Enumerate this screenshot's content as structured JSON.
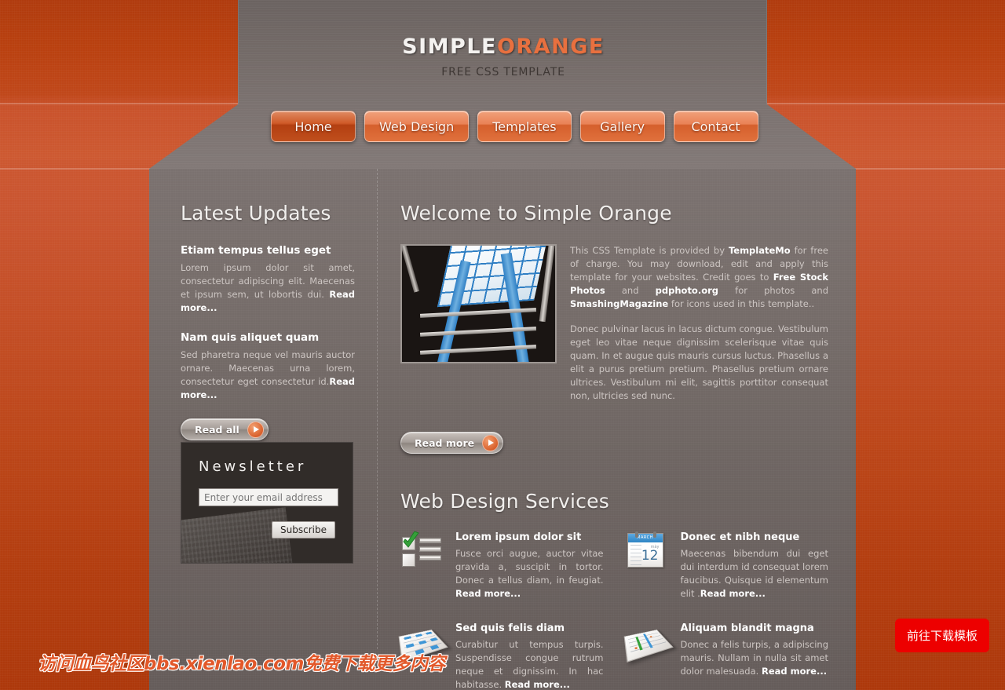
{
  "header": {
    "brand_primary": "SIMPLE",
    "brand_accent": "ORANGE",
    "tagline": "FREE CSS TEMPLATE",
    "accent_color": "#e8703f"
  },
  "nav": {
    "items": [
      {
        "label": "Home",
        "active": true
      },
      {
        "label": "Web Design",
        "active": false
      },
      {
        "label": "Templates",
        "active": false
      },
      {
        "label": "Gallery",
        "active": false
      },
      {
        "label": "Contact",
        "active": false
      }
    ]
  },
  "sidebar": {
    "title": "Latest Updates",
    "updates": [
      {
        "title": "Etiam tempus tellus eget",
        "text": "Lorem ipsum dolor sit amet, consectetur adipiscing elit. Maecenas et ipsum sem, ut lobortis dui. ",
        "read_more": "Read more..."
      },
      {
        "title": "Nam quis aliquet quam",
        "text": "Sed pharetra neque vel mauris auctor ornare. Maecenas urna lorem, consectetur eget consectetur id.",
        "read_more": "Read more..."
      }
    ],
    "read_all_label": "Read all"
  },
  "newsletter": {
    "title": "Newsletter",
    "input_placeholder": "Enter your email address",
    "input_value": "",
    "subscribe_label": "Subscribe"
  },
  "welcome": {
    "title": "Welcome to Simple Orange",
    "photo_alt": "blue metal stairs photo",
    "paragraph1_a": "This CSS Template is provided by ",
    "link_templatemo": "TemplateMo",
    "paragraph1_b": " for free of charge. You may download, edit and apply this template for your websites. Credit goes to ",
    "link_freestock": "Free Stock Photos",
    "paragraph1_c": " and ",
    "link_pdphoto": "pdphoto.org",
    "paragraph1_d": " for photos and ",
    "link_smashing": "SmashingMagazine",
    "paragraph1_e": " for icons used in this template..",
    "paragraph2": "Donec pulvinar lacus in lacus dictum congue. Vestibulum eget leo vitae neque dignissim scelerisque vitae quis quam. In et augue quis mauris cursus luctus. Phasellus a elit a purus pretium pretium. Phasellus pretium ornare ultrices. Vestibulum mi elit, sagittis porttitor consequat non, ultricies sed nunc.",
    "read_more_label": "Read more"
  },
  "services": {
    "title": "Web Design Services",
    "items": [
      {
        "icon": "checklist-icon",
        "title": "Lorem ipsum dolor sit",
        "text": "Fusce orci augue, auctor vitae gravida a, suscipit in tortor. Donec a tellus diam, in feugiat. ",
        "read_more": "Read more..."
      },
      {
        "icon": "calendar-icon",
        "title": "Donec et nibh neque",
        "text": "Maecenas bibendum dui eget dui interdum id consequat lorem faucibus. Quisque id elementum elit .",
        "read_more": "Read more..."
      },
      {
        "icon": "document-blocks-icon",
        "title": "Sed quis felis diam",
        "text": "Curabitur ut tempus turpis. Suspendisse congue rutrum neque et dignissim. In hac habitasse. ",
        "read_more": "Read more..."
      },
      {
        "icon": "document-chart-icon",
        "title": "Aliquam blandit magna",
        "text": "Donec a felis turpis, a adipiscing mauris. Nullam in nulla sit amet dolor malesuada. ",
        "read_more": "Read more..."
      }
    ]
  },
  "calendar_icon": {
    "month": "MARCH",
    "weekday": "mày",
    "day": "12"
  },
  "overlay": {
    "watermark": "访问血鸟社区bbs.xienlao.com免费下载更多内容",
    "watermark_color": "#e2582a",
    "download_button": "前往下载模板",
    "download_button_color": "#ed0000"
  }
}
